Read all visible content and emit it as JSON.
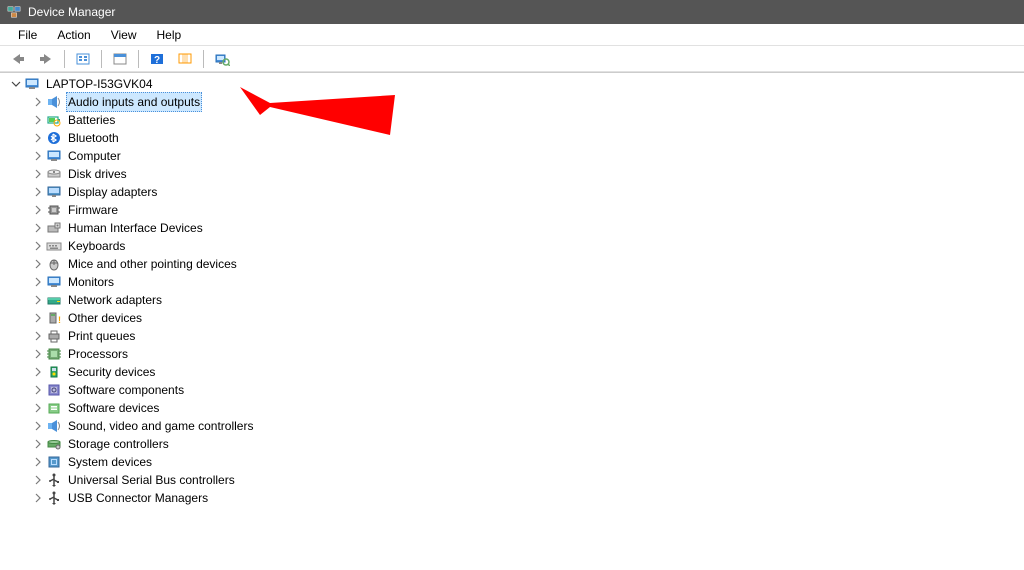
{
  "title": "Device Manager",
  "menu": {
    "file": "File",
    "action": "Action",
    "view": "View",
    "help": "Help"
  },
  "toolbar": {
    "back": "Back",
    "forward": "Forward",
    "up": "Up",
    "show_hidden": "Show hidden",
    "help": "Help",
    "properties": "Properties",
    "scan": "Scan for hardware changes"
  },
  "root_label": "LAPTOP-I53GVK04",
  "categories": [
    {
      "id": "audio",
      "label": "Audio inputs and outputs",
      "icon": "speaker",
      "selected": true
    },
    {
      "id": "batteries",
      "label": "Batteries",
      "icon": "battery",
      "selected": false
    },
    {
      "id": "bluetooth",
      "label": "Bluetooth",
      "icon": "bluetooth",
      "selected": false
    },
    {
      "id": "computer",
      "label": "Computer",
      "icon": "monitor",
      "selected": false
    },
    {
      "id": "disk",
      "label": "Disk drives",
      "icon": "disk",
      "selected": false
    },
    {
      "id": "display",
      "label": "Display adapters",
      "icon": "display",
      "selected": false
    },
    {
      "id": "firmware",
      "label": "Firmware",
      "icon": "chip",
      "selected": false
    },
    {
      "id": "hid",
      "label": "Human Interface Devices",
      "icon": "hid",
      "selected": false
    },
    {
      "id": "keyboards",
      "label": "Keyboards",
      "icon": "keyboard",
      "selected": false
    },
    {
      "id": "mice",
      "label": "Mice and other pointing devices",
      "icon": "mouse",
      "selected": false
    },
    {
      "id": "monitors",
      "label": "Monitors",
      "icon": "monitor",
      "selected": false
    },
    {
      "id": "network",
      "label": "Network adapters",
      "icon": "network",
      "selected": false
    },
    {
      "id": "other",
      "label": "Other devices",
      "icon": "other",
      "selected": false
    },
    {
      "id": "print",
      "label": "Print queues",
      "icon": "printer",
      "selected": false
    },
    {
      "id": "processors",
      "label": "Processors",
      "icon": "cpu",
      "selected": false
    },
    {
      "id": "security",
      "label": "Security devices",
      "icon": "security",
      "selected": false
    },
    {
      "id": "swcomp",
      "label": "Software components",
      "icon": "swcomp",
      "selected": false
    },
    {
      "id": "swdev",
      "label": "Software devices",
      "icon": "swdev",
      "selected": false
    },
    {
      "id": "sound",
      "label": "Sound, video and game controllers",
      "icon": "speaker",
      "selected": false
    },
    {
      "id": "storage",
      "label": "Storage controllers",
      "icon": "storage",
      "selected": false
    },
    {
      "id": "system",
      "label": "System devices",
      "icon": "system",
      "selected": false
    },
    {
      "id": "usb",
      "label": "Universal Serial Bus controllers",
      "icon": "usb",
      "selected": false
    },
    {
      "id": "usbconn",
      "label": "USB Connector Managers",
      "icon": "usb",
      "selected": false
    }
  ],
  "annotation_color": "#ff0000"
}
